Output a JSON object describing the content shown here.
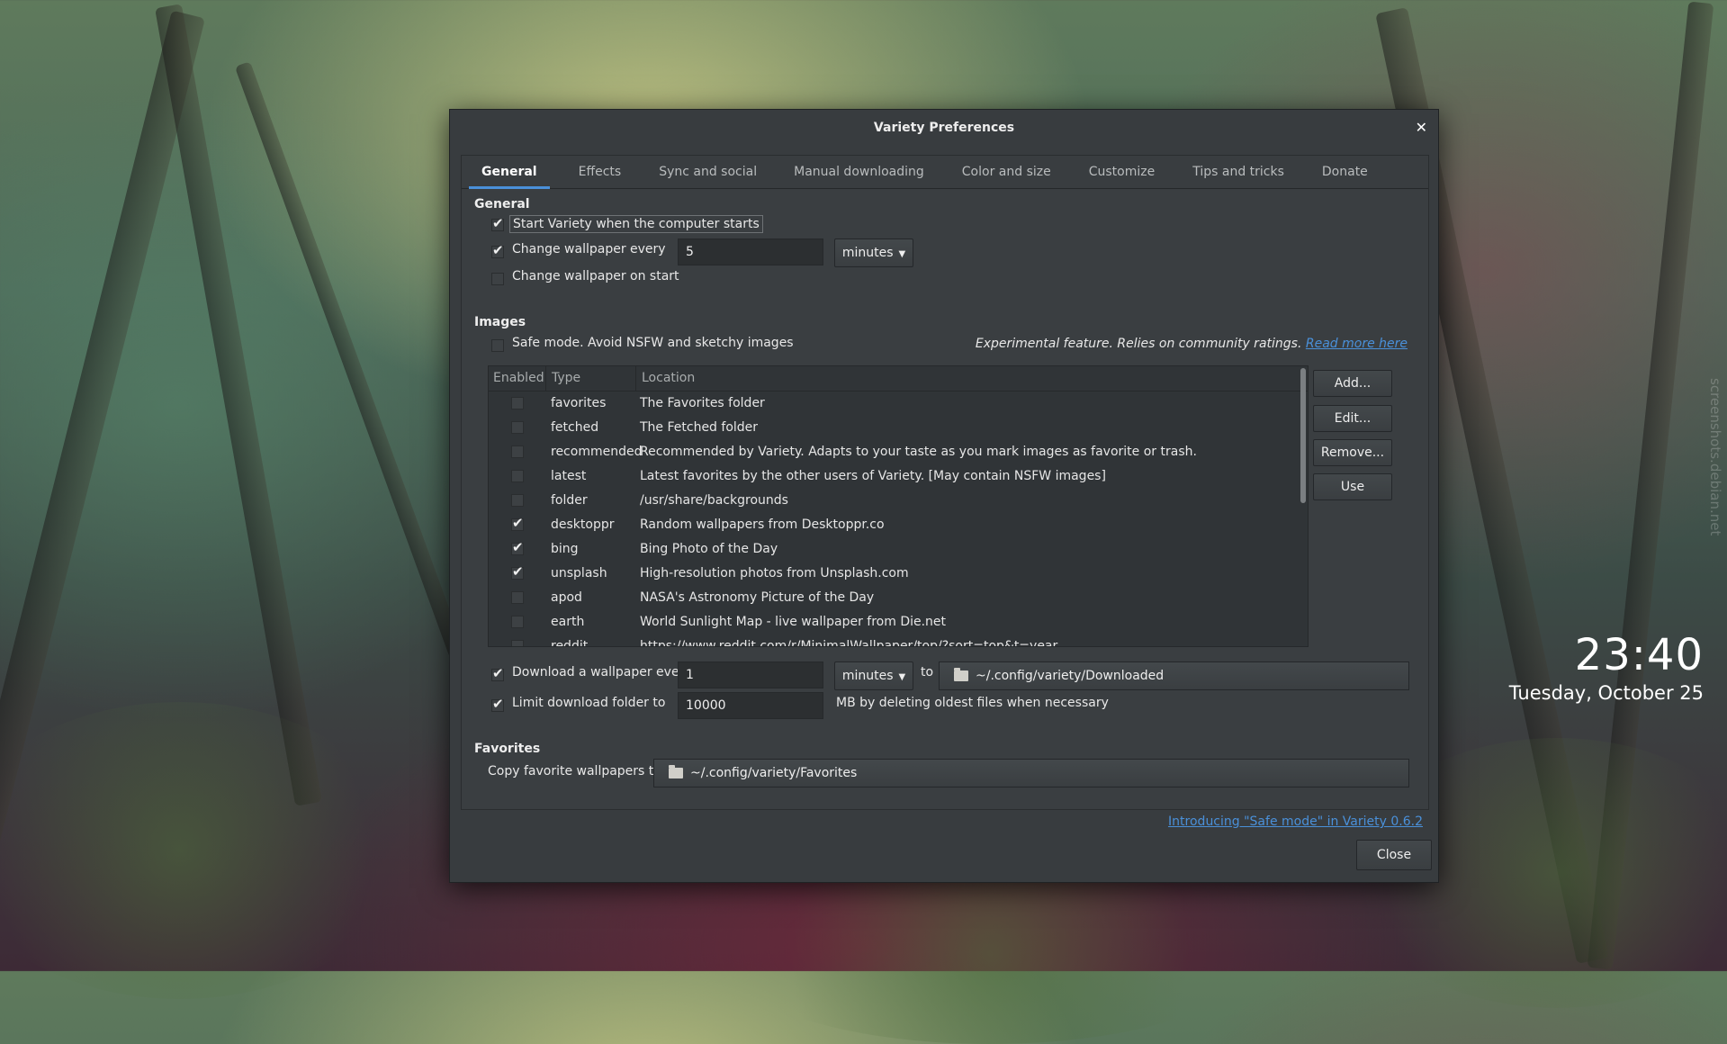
{
  "window": {
    "title": "Variety Preferences"
  },
  "tabs": [
    "General",
    "Effects",
    "Sync and social",
    "Manual downloading",
    "Color and size",
    "Customize",
    "Tips and tricks",
    "Donate"
  ],
  "general": {
    "section_title": "General",
    "start_on_login": {
      "label": "Start Variety when the computer starts",
      "checked": true
    },
    "change_every": {
      "label": "Change wallpaper every",
      "checked": true,
      "value": "5",
      "unit": "minutes"
    },
    "change_on_start": {
      "label": "Change wallpaper on start",
      "checked": false
    }
  },
  "images": {
    "section_title": "Images",
    "safe_mode": {
      "label": "Safe mode. Avoid NSFW and sketchy images",
      "checked": false
    },
    "safe_note": "Experimental feature. Relies on community ratings.",
    "safe_link": "Read more here",
    "columns": [
      "Enabled",
      "Type",
      "Location"
    ],
    "sources": [
      {
        "enabled": false,
        "type": "favorites",
        "location": "The Favorites folder"
      },
      {
        "enabled": false,
        "type": "fetched",
        "location": "The Fetched folder"
      },
      {
        "enabled": false,
        "type": "recommended",
        "location": "Recommended by Variety. Adapts to your taste as you mark images as favorite or trash."
      },
      {
        "enabled": false,
        "type": "latest",
        "location": "Latest favorites by the other users of Variety. [May contain NSFW images]"
      },
      {
        "enabled": false,
        "type": "folder",
        "location": "/usr/share/backgrounds"
      },
      {
        "enabled": true,
        "type": "desktoppr",
        "location": "Random wallpapers from Desktoppr.co"
      },
      {
        "enabled": true,
        "type": "bing",
        "location": "Bing Photo of the Day"
      },
      {
        "enabled": true,
        "type": "unsplash",
        "location": "High-resolution photos from Unsplash.com"
      },
      {
        "enabled": false,
        "type": "apod",
        "location": "NASA's Astronomy Picture of the Day"
      },
      {
        "enabled": false,
        "type": "earth",
        "location": "World Sunlight Map - live wallpaper from Die.net"
      },
      {
        "enabled": false,
        "type": "reddit",
        "location": "https://www.reddit.com/r/MinimalWallpaper/top/?sort=top&t=year"
      }
    ],
    "buttons": {
      "add": "Add...",
      "edit": "Edit...",
      "remove": "Remove...",
      "use": "Use"
    },
    "download": {
      "label": "Download a wallpaper every",
      "checked": true,
      "value": "1",
      "unit": "minutes",
      "to": "to",
      "folder": "~/.config/variety/Downloaded"
    },
    "limit": {
      "label": "Limit download folder to",
      "checked": true,
      "value": "10000",
      "suffix": "MB by deleting oldest files when necessary"
    }
  },
  "favorites": {
    "section_title": "Favorites",
    "copy_label": "Copy favorite wallpapers to",
    "folder": "~/.config/variety/Favorites"
  },
  "footer": {
    "intro_link": "Introducing \"Safe mode\" in Variety 0.6.2",
    "close": "Close"
  },
  "desktop": {
    "time": "23:40",
    "date": "Tuesday, October 25",
    "watermark": "screenshots.debian.net"
  },
  "colors": {
    "accent": "#4a90d9",
    "window_bg": "#383c3f"
  }
}
